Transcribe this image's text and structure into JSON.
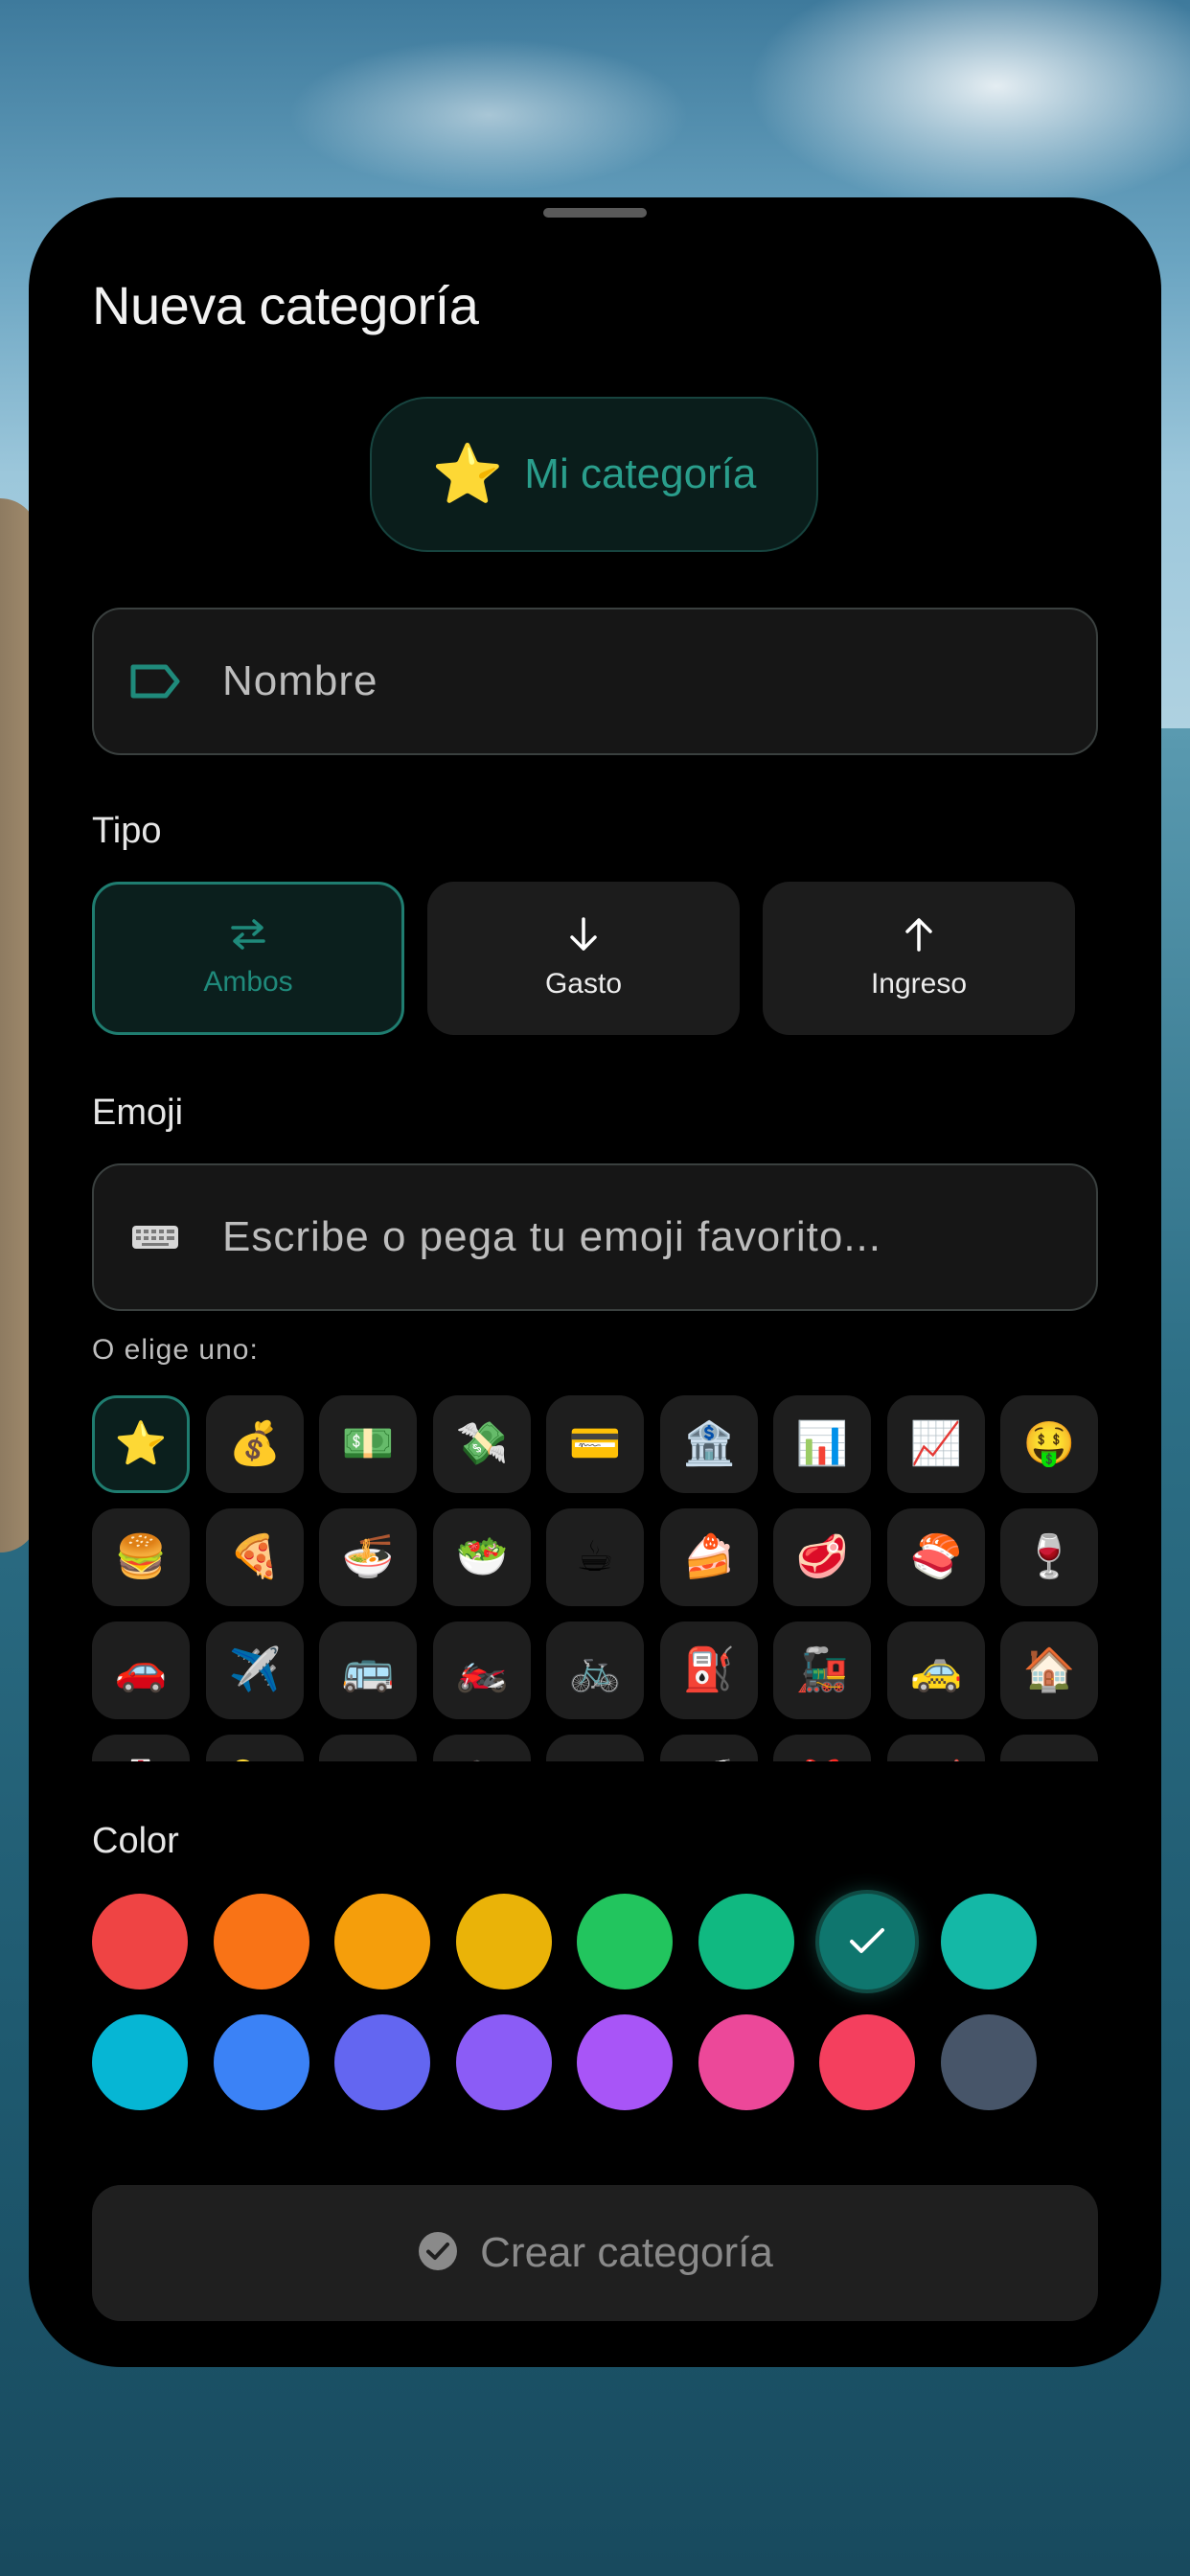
{
  "sheet": {
    "title": "Nueva categoría"
  },
  "preview": {
    "emoji": "⭐",
    "label": "Mi categoría",
    "accent": "#2a9e8c"
  },
  "name_field": {
    "icon": "tag-icon",
    "placeholder": "Nombre",
    "value": ""
  },
  "type": {
    "label": "Tipo",
    "options": [
      {
        "label": "Ambos",
        "icon": "swap-arrows-icon",
        "selected": true
      },
      {
        "label": "Gasto",
        "icon": "arrow-down-icon",
        "selected": false
      },
      {
        "label": "Ingreso",
        "icon": "arrow-up-icon",
        "selected": false
      }
    ]
  },
  "emoji_section": {
    "label": "Emoji",
    "input_icon": "keyboard-icon",
    "input_placeholder": "Escribe o pega tu emoji favorito...",
    "choose_label": "O elige uno:",
    "rows": [
      [
        "⭐",
        "💰",
        "💵",
        "💸",
        "💳",
        "🏦",
        "📊",
        "📈",
        "🤑"
      ],
      [
        "🍔",
        "🍕",
        "🍜",
        "🥗",
        "☕",
        "🍰",
        "🥩",
        "🍣",
        "🍷"
      ],
      [
        "🚗",
        "✈️",
        "🚌",
        "🏍️",
        "🚲",
        "⛽",
        "🚂",
        "🚕",
        "🏠"
      ],
      [
        "🏥",
        "💊",
        "🎓",
        "📚",
        "🎮",
        "🎬",
        "🎁",
        "🛒",
        "👕"
      ]
    ],
    "selected": "⭐"
  },
  "color_section": {
    "label": "Color",
    "colors": [
      "#ef4444",
      "#f97316",
      "#f59e0b",
      "#eab308",
      "#22c55e",
      "#10b981",
      "#0f766e",
      "#14b8a6",
      "#06b6d4",
      "#3b82f6",
      "#6366f1",
      "#8b5cf6",
      "#a855f7",
      "#ec4899",
      "#f43f5e",
      "#475569"
    ],
    "selected_index": 6
  },
  "create_button": {
    "label": "Crear categoría",
    "icon": "check-circle-icon"
  }
}
